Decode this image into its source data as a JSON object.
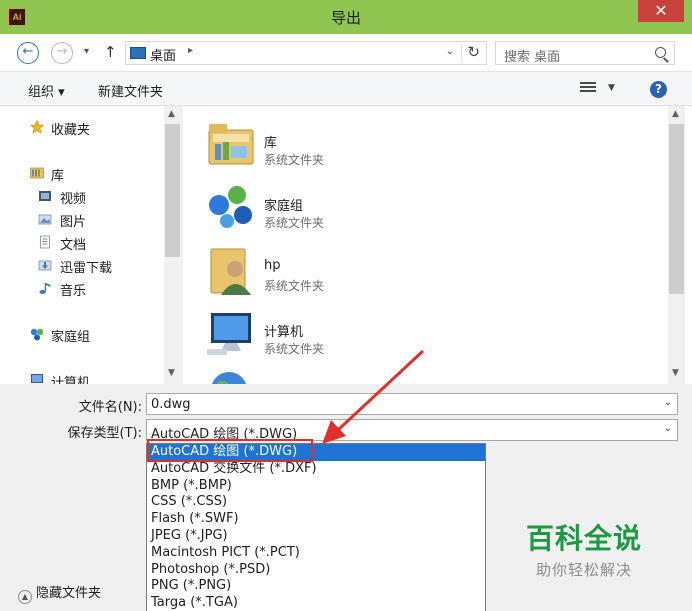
{
  "window": {
    "title": "导出",
    "app_icon": "Ai",
    "close": "✕"
  },
  "address": {
    "location": "桌面",
    "search_placeholder": "搜索 桌面"
  },
  "toolbar": {
    "organize": "组织 ▾",
    "new_folder": "新建文件夹"
  },
  "nav": {
    "favorites": "收藏夹",
    "library": "库",
    "videos": "视频",
    "pictures": "图片",
    "documents": "文档",
    "thunder": "迅雷下载",
    "music": "音乐",
    "homegroup": "家庭组",
    "computer": "计算机"
  },
  "files": [
    {
      "name": "库",
      "type": "系统文件夹"
    },
    {
      "name": "家庭组",
      "type": "系统文件夹"
    },
    {
      "name": "hp",
      "type": "系统文件夹"
    },
    {
      "name": "计算机",
      "type": "系统文件夹"
    },
    {
      "name": "网络",
      "type": ""
    }
  ],
  "form": {
    "filename_label": "文件名(N):",
    "filename_value": "0.dwg",
    "filetype_label": "保存类型(T):",
    "filetype_value": "AutoCAD 绘图 (*.DWG)",
    "options": [
      "AutoCAD 绘图 (*.DWG)",
      "AutoCAD 交换文件 (*.DXF)",
      "BMP (*.BMP)",
      "CSS (*.CSS)",
      "Flash (*.SWF)",
      "JPEG (*.JPG)",
      "Macintosh PICT (*.PCT)",
      "Photoshop (*.PSD)",
      "PNG (*.PNG)",
      "Targa (*.TGA)"
    ],
    "hide_folders": "隐藏文件夹"
  },
  "watermark": {
    "title": "百科全说",
    "subtitle": "助你轻松解决"
  },
  "colors": {
    "title_bar": "#8fc651",
    "close_button": "#c7423a",
    "selection": "#1e73d4",
    "highlight": "#e0302a",
    "watermark": "#1c9a42"
  }
}
